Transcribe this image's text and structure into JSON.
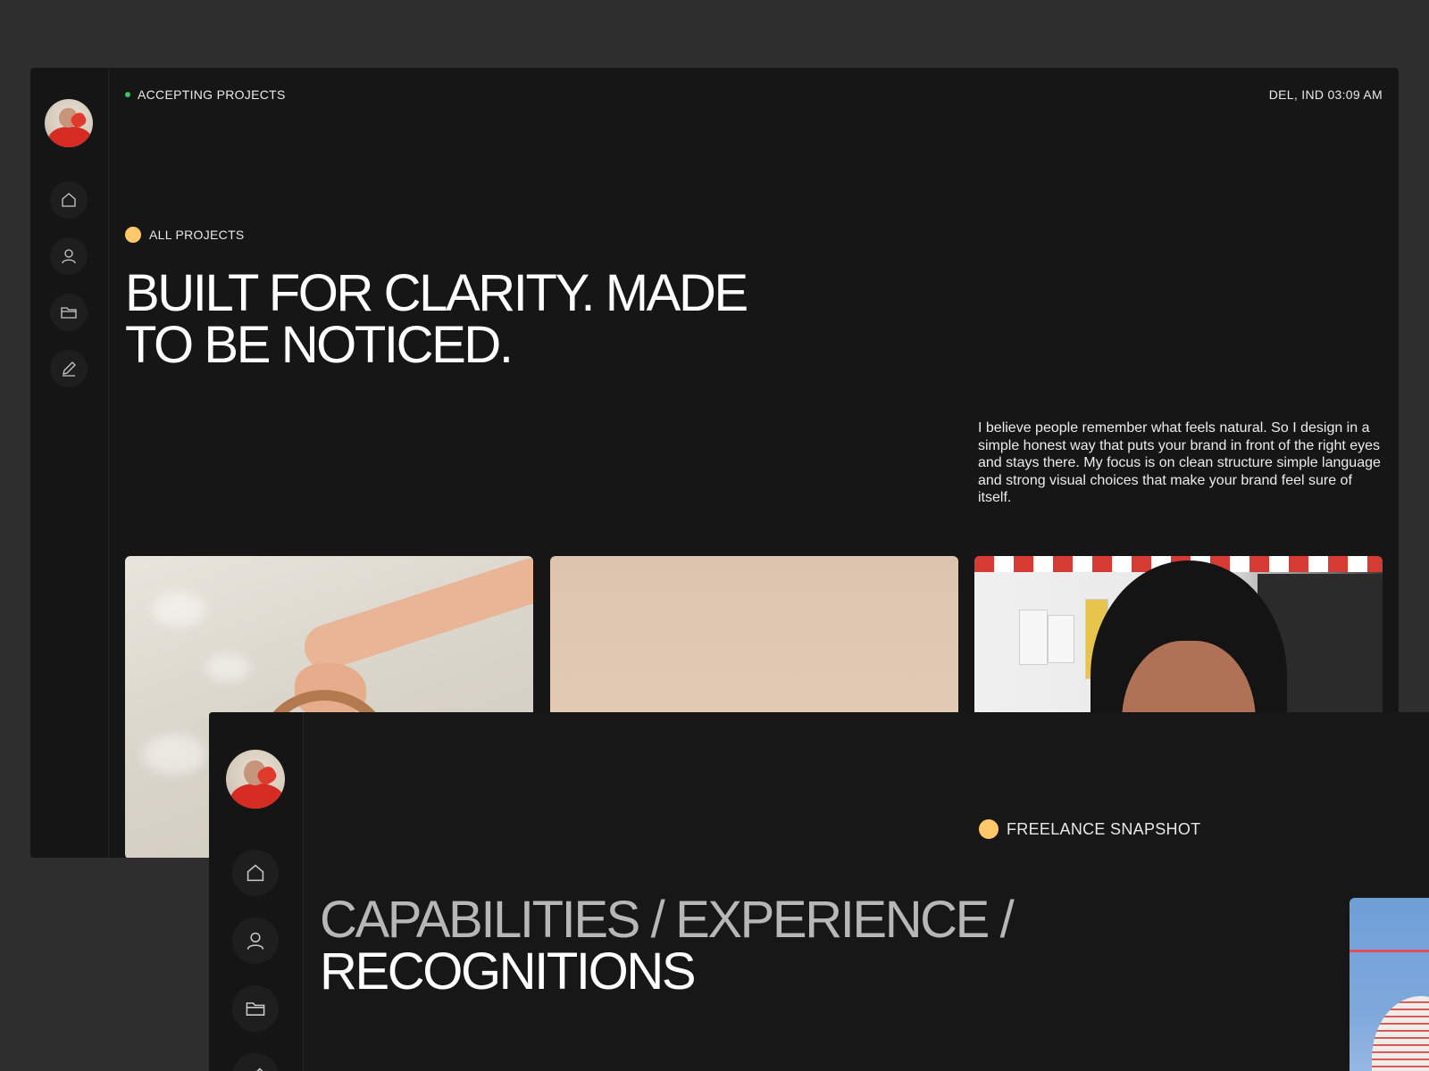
{
  "window_top": {
    "status": "ACCEPTING PROJECTS",
    "location_time": "DEL, IND 03:09 AM",
    "section_label": "ALL PROJECTS",
    "hero_title": "BUILT FOR CLARITY. MADE TO BE NOTICED.",
    "intro": "I believe people remember what feels natural. So I design in a simple honest way that puts your brand in front of the right eyes and stays there. My focus is on clean structure simple language and strong visual choices that make your brand feel sure of itself.",
    "nav_icons": [
      "home-icon",
      "user-icon",
      "folder-icon",
      "pencil-icon"
    ],
    "status_color": "#34c759",
    "accent_color": "#ffc86a"
  },
  "window_bottom": {
    "section_label": "FREELANCE SNAPSHOT",
    "title_muted": "CAPABILITIES / EXPERIENCE /",
    "title_strong": "RECOGNITIONS",
    "nav_icons": [
      "home-icon",
      "user-icon",
      "folder-icon",
      "pencil-icon"
    ]
  }
}
